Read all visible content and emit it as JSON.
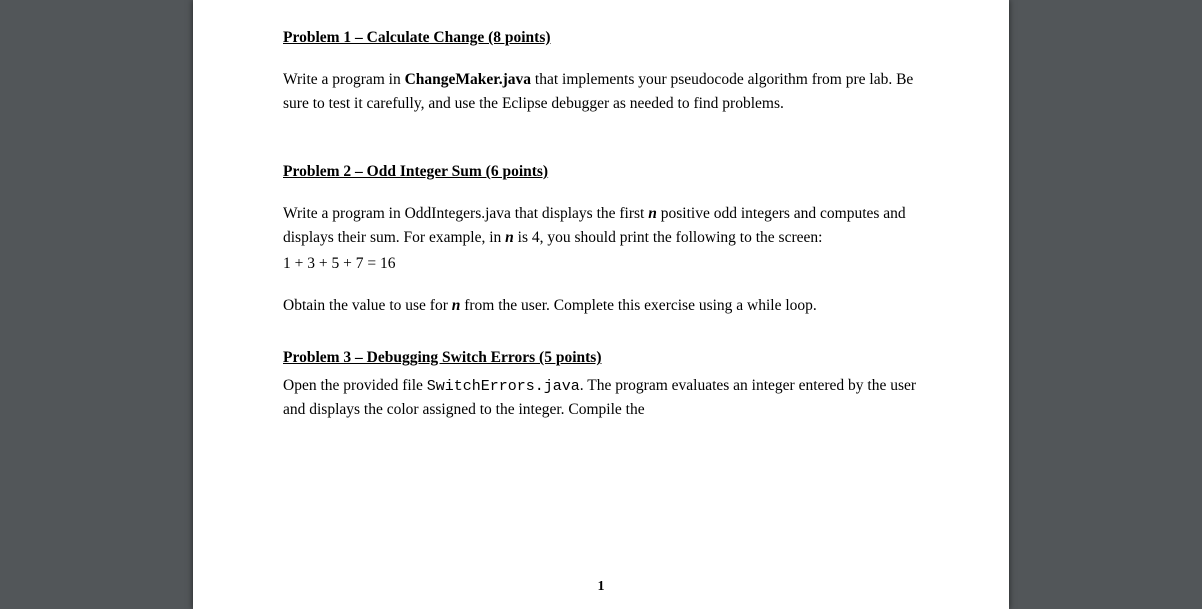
{
  "page_number": "1",
  "problems": {
    "p1": {
      "heading": "Problem 1 – Calculate Change (8 points)",
      "para1_a": "Write a program in ",
      "para1_b": "ChangeMaker.java",
      "para1_c": " that implements your pseudocode algorithm from pre lab. Be sure to test it carefully, and use the Eclipse debugger as needed to find problems."
    },
    "p2": {
      "heading": "Problem 2 – Odd Integer Sum (6 points)",
      "para1_a": "Write a program in OddIntegers.java that displays the first ",
      "para1_b": "n",
      "para1_c": " positive odd integers and computes and displays their sum. For example, in ",
      "para1_d": "n",
      "para1_e": " is 4, you should print the following to the screen:",
      "sample": "1 + 3 + 5 + 7 = 16",
      "para2_a": "Obtain the value to use for ",
      "para2_b": "n",
      "para2_c": " from the user. Complete this exercise using a while loop."
    },
    "p3": {
      "heading": "Problem 3 – Debugging Switch Errors (5 points)",
      "para1_a": "Open the provided file ",
      "para1_b": "SwitchErrors.java",
      "para1_c": ". The program evaluates an integer entered by the user and displays the color assigned to the integer.  Compile the"
    }
  }
}
